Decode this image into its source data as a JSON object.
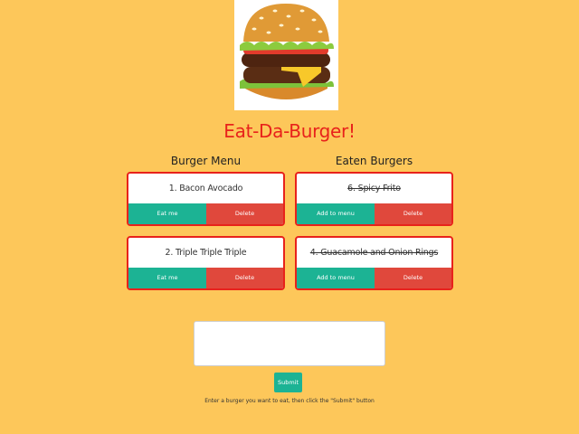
{
  "app": {
    "title": "Eat-Da-Burger!",
    "hero_image_icon": "burger-illustration"
  },
  "menu": {
    "heading": "Burger Menu",
    "items": [
      {
        "name": "1. Bacon Avocado",
        "action_label": "Eat me",
        "delete_label": "Delete"
      },
      {
        "name": "2. Triple Triple Triple",
        "action_label": "Eat me",
        "delete_label": "Delete"
      }
    ]
  },
  "eaten": {
    "heading": "Eaten Burgers",
    "items": [
      {
        "name": "6. Spicy Frito",
        "action_label": "Add to menu",
        "delete_label": "Delete"
      },
      {
        "name": "4. Guacamole and Onion Rings",
        "action_label": "Add to menu",
        "delete_label": "Delete"
      }
    ]
  },
  "form": {
    "textarea_value": "",
    "submit_label": "Submit",
    "hint": "Enter a burger you want to eat, then click the \"Submit\" button"
  },
  "colors": {
    "background": "#fdc75a",
    "accent_red": "#e8221b",
    "teal_button": "#1cb394",
    "delete_button": "#e0483c"
  }
}
